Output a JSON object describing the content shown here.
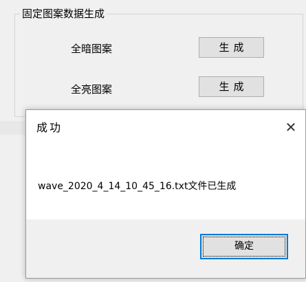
{
  "group": {
    "title": "固定图案数据生成",
    "rows": [
      {
        "label": "全暗图案",
        "button": "生成"
      },
      {
        "label": "全亮图案",
        "button": "生成"
      }
    ]
  },
  "dialog": {
    "title": "成功",
    "close_icon": "close-icon",
    "message": "wave_2020_4_14_10_45_16.txt文件已生成",
    "ok_label": "确定"
  }
}
